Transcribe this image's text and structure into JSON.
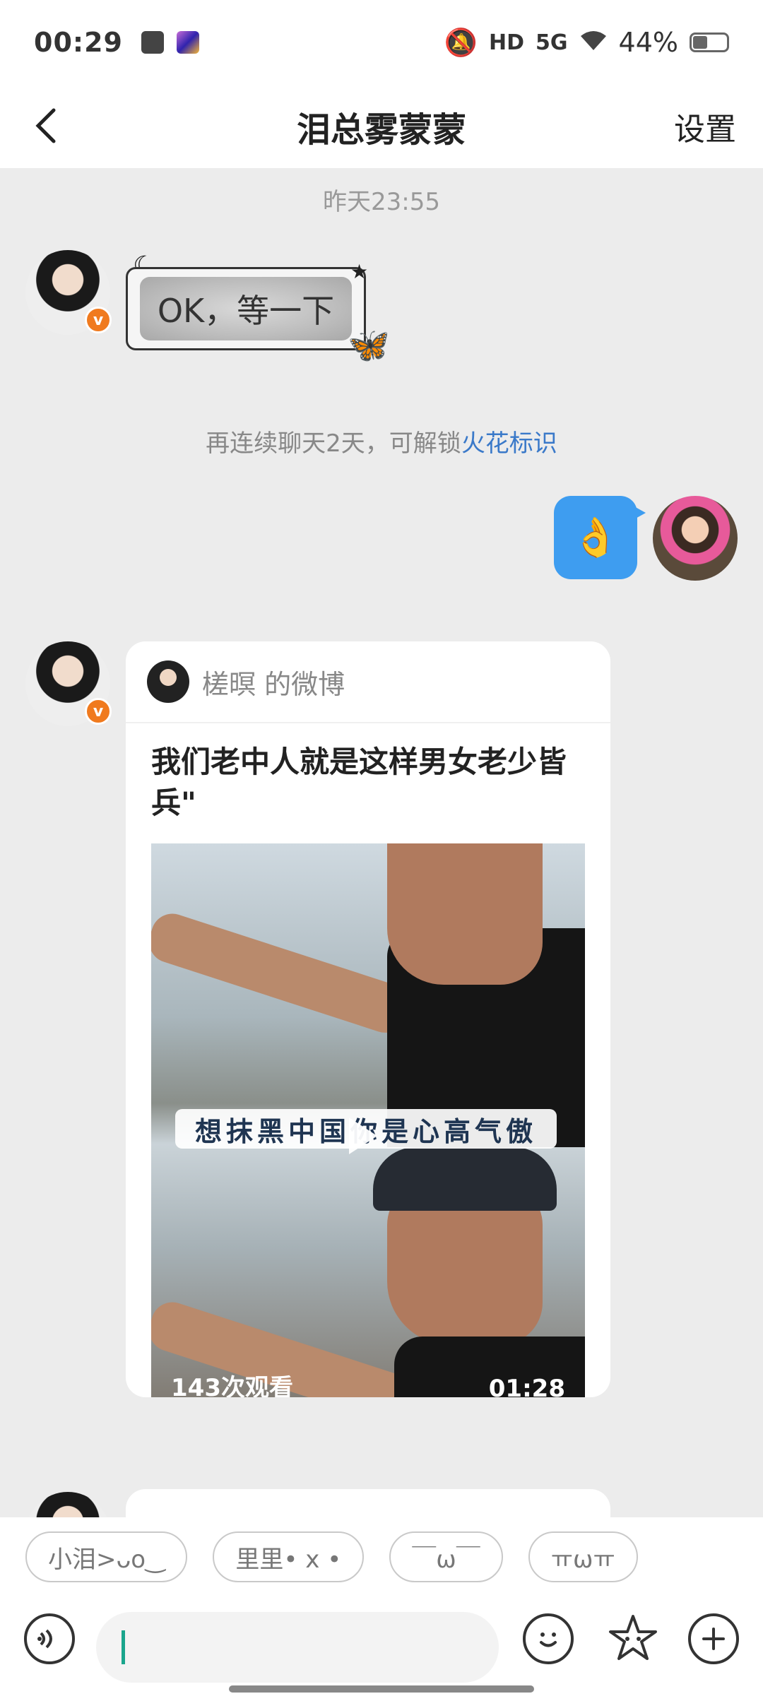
{
  "status_bar": {
    "time": "00:29",
    "network": "5G",
    "hd": "HD",
    "battery": "44%",
    "battery_level": 0.44,
    "icons": [
      "mail-icon",
      "app-icon",
      "bell-muted-icon",
      "hd-icon",
      "signal-icon",
      "wifi-icon",
      "battery-icon"
    ]
  },
  "header": {
    "title": "泪总雾蒙蒙",
    "settings_label": "设置"
  },
  "chat": {
    "timestamp": "昨天23:55",
    "sticker_text": "OK，等一下",
    "hint_prefix": "再连续聊天2天，可解锁",
    "hint_link": "火花标识",
    "my_message_emoji": "👌",
    "card": {
      "source": "槎暝 的微博",
      "text": "我们老中人就是这样男女老少皆兵\"",
      "video_caption": "想抹黑中国你是心高气傲",
      "views": "143次观看",
      "duration": "01:28"
    }
  },
  "quick_replies": [
    "小泪>ᴗo‿",
    "里里• x •",
    "￣ω￣",
    "ㅠωㅠ"
  ],
  "input": {
    "placeholder": ""
  },
  "colors": {
    "accent": "#3e9df0",
    "link": "#3a79c9",
    "badge": "#f07a1e"
  }
}
